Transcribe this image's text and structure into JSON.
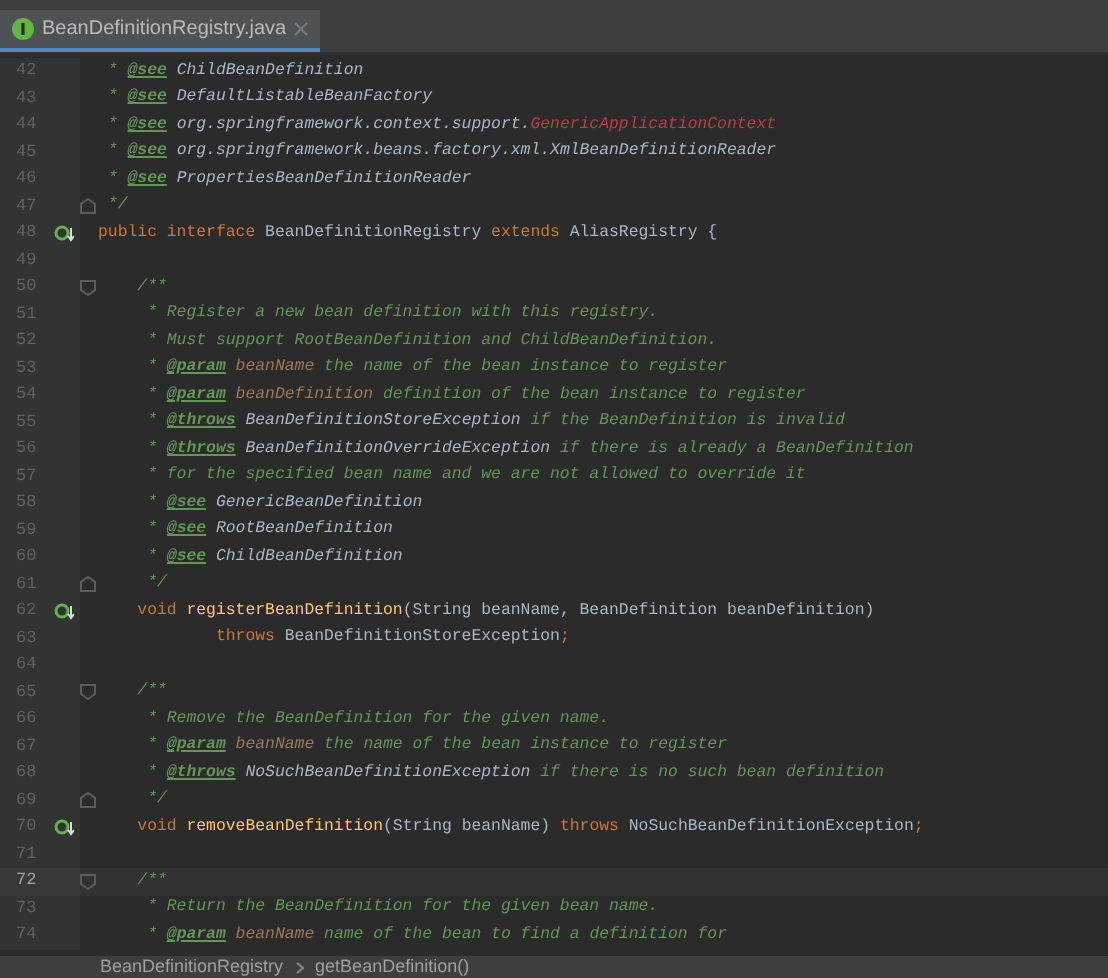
{
  "tab": {
    "label": "BeanDefinitionRegistry.java",
    "selected": true
  },
  "lines": [
    {
      "number": "42",
      "current": false,
      "implemented": false,
      "fold_start": false,
      "fold_end": false,
      "segments": [
        {
          "kind": "comment",
          "text": " * "
        },
        {
          "kind": "tag",
          "text": "@see"
        },
        {
          "kind": "ref",
          "text": " ChildBeanDefinition"
        }
      ]
    },
    {
      "number": "43",
      "current": false,
      "implemented": false,
      "fold_start": false,
      "fold_end": false,
      "segments": [
        {
          "kind": "comment",
          "text": " * "
        },
        {
          "kind": "tag",
          "text": "@see"
        },
        {
          "kind": "ref",
          "text": " DefaultListableBeanFactory"
        }
      ]
    },
    {
      "number": "44",
      "current": false,
      "implemented": false,
      "fold_start": false,
      "fold_end": false,
      "segments": [
        {
          "kind": "comment",
          "text": " * "
        },
        {
          "kind": "tag",
          "text": "@see"
        },
        {
          "kind": "ref",
          "text": " org.springframework.context.support."
        },
        {
          "kind": "error",
          "text": "GenericApplicationContext"
        }
      ]
    },
    {
      "number": "45",
      "current": false,
      "implemented": false,
      "fold_start": false,
      "fold_end": false,
      "segments": [
        {
          "kind": "comment",
          "text": " * "
        },
        {
          "kind": "tag",
          "text": "@see"
        },
        {
          "kind": "ref",
          "text": " org.springframework.beans.factory.xml.XmlBeanDefinitionReader"
        }
      ]
    },
    {
      "number": "46",
      "current": false,
      "implemented": false,
      "fold_start": false,
      "fold_end": false,
      "segments": [
        {
          "kind": "comment",
          "text": " * "
        },
        {
          "kind": "tag",
          "text": "@see"
        },
        {
          "kind": "ref",
          "text": " PropertiesBeanDefinitionReader"
        }
      ]
    },
    {
      "number": "47",
      "current": false,
      "implemented": false,
      "fold_start": false,
      "fold_end": true,
      "segments": [
        {
          "kind": "comment",
          "text": " */"
        }
      ]
    },
    {
      "number": "48",
      "current": false,
      "implemented": true,
      "fold_start": false,
      "fold_end": false,
      "segments": [
        {
          "kind": "keyword",
          "text": "public interface "
        },
        {
          "kind": "plain",
          "text": "BeanDefinitionRegistry "
        },
        {
          "kind": "keyword",
          "text": "extends "
        },
        {
          "kind": "plain",
          "text": "AliasRegistry {"
        }
      ]
    },
    {
      "number": "49",
      "current": false,
      "implemented": false,
      "fold_start": false,
      "fold_end": false
    },
    {
      "number": "50",
      "current": false,
      "implemented": false,
      "fold_start": true,
      "fold_end": false,
      "segments": [
        {
          "kind": "comment",
          "text": "    /**"
        }
      ]
    },
    {
      "number": "51",
      "current": false,
      "implemented": false,
      "fold_start": false,
      "fold_end": false,
      "segments": [
        {
          "kind": "comment",
          "text": "     * Register a new bean definition with this registry."
        }
      ]
    },
    {
      "number": "52",
      "current": false,
      "implemented": false,
      "fold_start": false,
      "fold_end": false,
      "segments": [
        {
          "kind": "comment",
          "text": "     * Must support RootBeanDefinition and ChildBeanDefinition."
        }
      ]
    },
    {
      "number": "53",
      "current": false,
      "implemented": false,
      "fold_start": false,
      "fold_end": false,
      "segments": [
        {
          "kind": "comment",
          "text": "     * "
        },
        {
          "kind": "tag",
          "text": "@param"
        },
        {
          "kind": "param",
          "text": " beanName"
        },
        {
          "kind": "comment",
          "text": " the name of the bean instance to register"
        }
      ]
    },
    {
      "number": "54",
      "current": false,
      "implemented": false,
      "fold_start": false,
      "fold_end": false,
      "segments": [
        {
          "kind": "comment",
          "text": "     * "
        },
        {
          "kind": "tag",
          "text": "@param"
        },
        {
          "kind": "param",
          "text": " beanDefinition"
        },
        {
          "kind": "comment",
          "text": " definition of the bean instance to register"
        }
      ]
    },
    {
      "number": "55",
      "current": false,
      "implemented": false,
      "fold_start": false,
      "fold_end": false,
      "segments": [
        {
          "kind": "comment",
          "text": "     * "
        },
        {
          "kind": "tag",
          "text": "@throws"
        },
        {
          "kind": "ref",
          "text": " BeanDefinitionStoreException"
        },
        {
          "kind": "comment",
          "text": " if the BeanDefinition is invalid"
        }
      ]
    },
    {
      "number": "56",
      "current": false,
      "implemented": false,
      "fold_start": false,
      "fold_end": false,
      "segments": [
        {
          "kind": "comment",
          "text": "     * "
        },
        {
          "kind": "tag",
          "text": "@throws"
        },
        {
          "kind": "ref",
          "text": " BeanDefinitionOverrideException"
        },
        {
          "kind": "comment",
          "text": " if there is already a BeanDefinition"
        }
      ]
    },
    {
      "number": "57",
      "current": false,
      "implemented": false,
      "fold_start": false,
      "fold_end": false,
      "segments": [
        {
          "kind": "comment",
          "text": "     * for the specified bean name and we are not allowed to override it"
        }
      ]
    },
    {
      "number": "58",
      "current": false,
      "implemented": false,
      "fold_start": false,
      "fold_end": false,
      "segments": [
        {
          "kind": "comment",
          "text": "     * "
        },
        {
          "kind": "tag",
          "text": "@see"
        },
        {
          "kind": "ref",
          "text": " GenericBeanDefinition"
        }
      ]
    },
    {
      "number": "59",
      "current": false,
      "implemented": false,
      "fold_start": false,
      "fold_end": false,
      "segments": [
        {
          "kind": "comment",
          "text": "     * "
        },
        {
          "kind": "tag",
          "text": "@see"
        },
        {
          "kind": "ref",
          "text": " RootBeanDefinition"
        }
      ]
    },
    {
      "number": "60",
      "current": false,
      "implemented": false,
      "fold_start": false,
      "fold_end": false,
      "segments": [
        {
          "kind": "comment",
          "text": "     * "
        },
        {
          "kind": "tag",
          "text": "@see"
        },
        {
          "kind": "ref",
          "text": " ChildBeanDefinition"
        }
      ]
    },
    {
      "number": "61",
      "current": false,
      "implemented": false,
      "fold_start": false,
      "fold_end": true,
      "segments": [
        {
          "kind": "comment",
          "text": "     */"
        }
      ]
    },
    {
      "number": "62",
      "current": false,
      "implemented": true,
      "fold_start": false,
      "fold_end": false,
      "segments": [
        {
          "kind": "keyword",
          "text": "    void "
        },
        {
          "kind": "method",
          "text": "registerBeanDefinition"
        },
        {
          "kind": "plain",
          "text": "(String beanName, BeanDefinition beanDefinition)"
        }
      ]
    },
    {
      "number": "63",
      "current": false,
      "implemented": false,
      "fold_start": false,
      "fold_end": false,
      "segments": [
        {
          "kind": "keyword",
          "text": "            throws "
        },
        {
          "kind": "plain",
          "text": "BeanDefinitionStoreException"
        },
        {
          "kind": "keyword",
          "text": ";"
        }
      ]
    },
    {
      "number": "64",
      "current": false,
      "implemented": false,
      "fold_start": false,
      "fold_end": false
    },
    {
      "number": "65",
      "current": false,
      "implemented": false,
      "fold_start": true,
      "fold_end": false,
      "segments": [
        {
          "kind": "comment",
          "text": "    /**"
        }
      ]
    },
    {
      "number": "66",
      "current": false,
      "implemented": false,
      "fold_start": false,
      "fold_end": false,
      "segments": [
        {
          "kind": "comment",
          "text": "     * Remove the BeanDefinition for the given name."
        }
      ]
    },
    {
      "number": "67",
      "current": false,
      "implemented": false,
      "fold_start": false,
      "fold_end": false,
      "segments": [
        {
          "kind": "comment",
          "text": "     * "
        },
        {
          "kind": "tag",
          "text": "@param"
        },
        {
          "kind": "param",
          "text": " beanName"
        },
        {
          "kind": "comment",
          "text": " the name of the bean instance to register"
        }
      ]
    },
    {
      "number": "68",
      "current": false,
      "implemented": false,
      "fold_start": false,
      "fold_end": false,
      "segments": [
        {
          "kind": "comment",
          "text": "     * "
        },
        {
          "kind": "tag",
          "text": "@throws"
        },
        {
          "kind": "ref",
          "text": " NoSuchBeanDefinitionException"
        },
        {
          "kind": "comment",
          "text": " if there is no such bean definition"
        }
      ]
    },
    {
      "number": "69",
      "current": false,
      "implemented": false,
      "fold_start": false,
      "fold_end": true,
      "segments": [
        {
          "kind": "comment",
          "text": "     */"
        }
      ]
    },
    {
      "number": "70",
      "current": false,
      "implemented": true,
      "fold_start": false,
      "fold_end": false,
      "segments": [
        {
          "kind": "keyword",
          "text": "    void "
        },
        {
          "kind": "method",
          "text": "removeBeanDefinition"
        },
        {
          "kind": "plain",
          "text": "(String beanName) "
        },
        {
          "kind": "keyword",
          "text": "throws "
        },
        {
          "kind": "plain",
          "text": "NoSuchBeanDefinitionException"
        },
        {
          "kind": "keyword",
          "text": ";"
        }
      ]
    },
    {
      "number": "71",
      "current": false,
      "implemented": false,
      "fold_start": false,
      "fold_end": false
    },
    {
      "number": "72",
      "current": true,
      "implemented": false,
      "fold_start": true,
      "fold_end": false,
      "segments": [
        {
          "kind": "comment",
          "text": "    /**"
        }
      ]
    },
    {
      "number": "73",
      "current": false,
      "implemented": false,
      "fold_start": false,
      "fold_end": false,
      "segments": [
        {
          "kind": "comment",
          "text": "     * Return the BeanDefinition for the given bean name."
        }
      ]
    },
    {
      "number": "74",
      "current": false,
      "implemented": false,
      "fold_start": false,
      "fold_end": false,
      "segments": [
        {
          "kind": "comment",
          "text": "     * "
        },
        {
          "kind": "tag",
          "text": "@param"
        },
        {
          "kind": "param",
          "text": " beanName"
        },
        {
          "kind": "comment",
          "text": " name of the bean to find a definition for"
        }
      ]
    }
  ],
  "breadcrumbs": [
    "BeanDefinitionRegistry",
    "getBeanDefinition()"
  ]
}
